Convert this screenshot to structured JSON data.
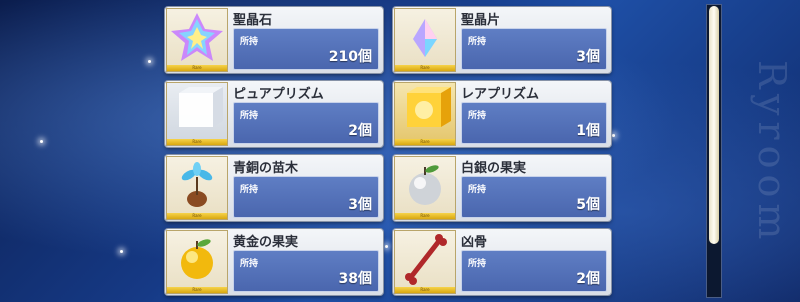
{
  "background_text": "Ryroom",
  "own_label": "所持",
  "rarity_label": "Rare",
  "items": [
    {
      "name": "聖晶石",
      "count": "210個",
      "icon": "saint-quartz-icon"
    },
    {
      "name": "聖晶片",
      "count": "3個",
      "icon": "quartz-fragment-icon"
    },
    {
      "name": "ピュアプリズム",
      "count": "2個",
      "icon": "pure-prism-icon"
    },
    {
      "name": "レアプリズム",
      "count": "1個",
      "icon": "rare-prism-icon"
    },
    {
      "name": "青銅の苗木",
      "count": "3個",
      "icon": "bronze-sapling-icon"
    },
    {
      "name": "白銀の果実",
      "count": "5個",
      "icon": "silver-apple-icon"
    },
    {
      "name": "黄金の果実",
      "count": "38個",
      "icon": "golden-apple-icon"
    },
    {
      "name": "凶骨",
      "count": "2個",
      "icon": "evil-bone-icon"
    }
  ],
  "scroll_position": 0.0
}
